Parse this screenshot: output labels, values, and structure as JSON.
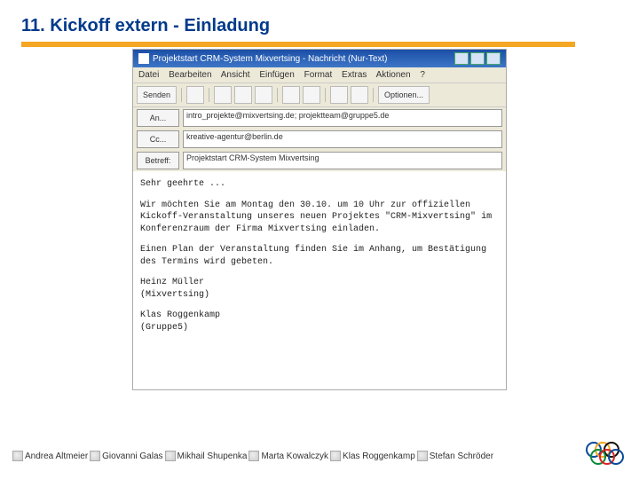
{
  "slide": {
    "title": "11. Kickoff extern - Einladung"
  },
  "window": {
    "title": "Projektstart CRM-System Mixvertsing - Nachricht (Nur-Text)",
    "menu": {
      "datei": "Datei",
      "bearbeiten": "Bearbeiten",
      "ansicht": "Ansicht",
      "einfuegen": "Einfügen",
      "format": "Format",
      "extras": "Extras",
      "aktionen": "Aktionen",
      "hilfe": "?"
    },
    "toolbar": {
      "senden": "Senden",
      "optionen": "Optionen..."
    },
    "fields": {
      "to_label": "An...",
      "to_value": "intro_projekte@mixvertsing.de; projektteam@gruppe5.de",
      "cc_label": "Cc...",
      "cc_value": "kreative-agentur@berlin.de",
      "subject_label": "Betreff:",
      "subject_value": "Projektstart CRM-System Mixvertsing"
    },
    "body": {
      "greeting": "Sehr geehrte ...",
      "p1": "Wir möchten Sie am Montag den 30.10. um 10 Uhr zur offiziellen Kickoff-Veranstaltung unseres neuen Projektes \"CRM-Mixvertsing\" im Konferenzraum der Firma Mixvertsing einladen.",
      "p2": "Einen Plan der Veranstaltung finden Sie im Anhang, um Bestätigung des Termins wird gebeten.",
      "sign1a": "Heinz Müller",
      "sign1b": "(Mixvertsing)",
      "sign2a": "Klas Roggenkamp",
      "sign2b": "(Gruppe5)"
    }
  },
  "footer": {
    "names": [
      "Andrea Altmeier",
      "Giovanni Galas",
      "Mikhail Shupenka",
      "Marta Kowalczyk",
      "Klas Roggenkamp",
      "Stefan Schröder"
    ]
  }
}
